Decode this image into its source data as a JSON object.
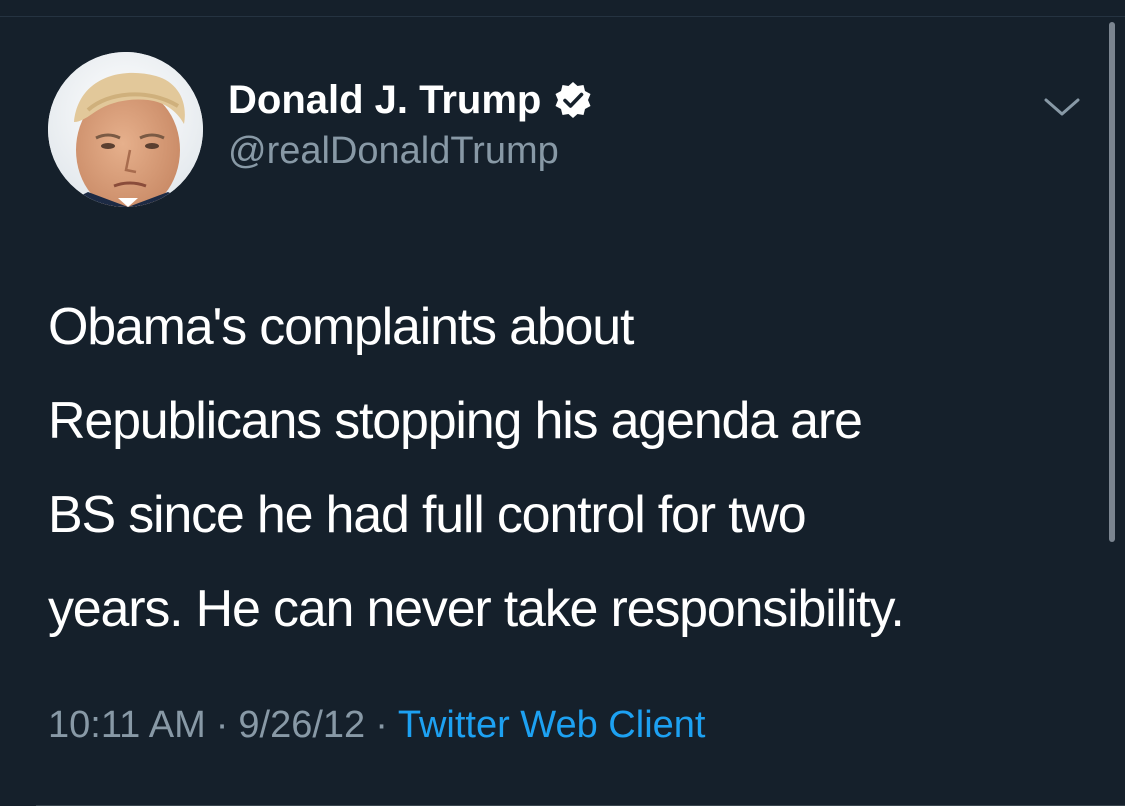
{
  "tweet": {
    "author": {
      "display_name": "Donald J. Trump",
      "handle": "@realDonaldTrump",
      "verified": true,
      "avatar": "profile-photo"
    },
    "text_lines": [
      "Obama's complaints about",
      "Republicans stopping his agenda are",
      "BS since he had full control for two",
      "years. He can never take responsibility."
    ],
    "meta": {
      "time": "10:11 AM",
      "separator": "·",
      "date": "9/26/12",
      "source": "Twitter Web Client"
    },
    "menu_icon": "chevron-down-icon"
  },
  "colors": {
    "background": "#15202b",
    "text": "#ffffff",
    "secondary_text": "#8899a6",
    "link": "#1da1f2"
  }
}
